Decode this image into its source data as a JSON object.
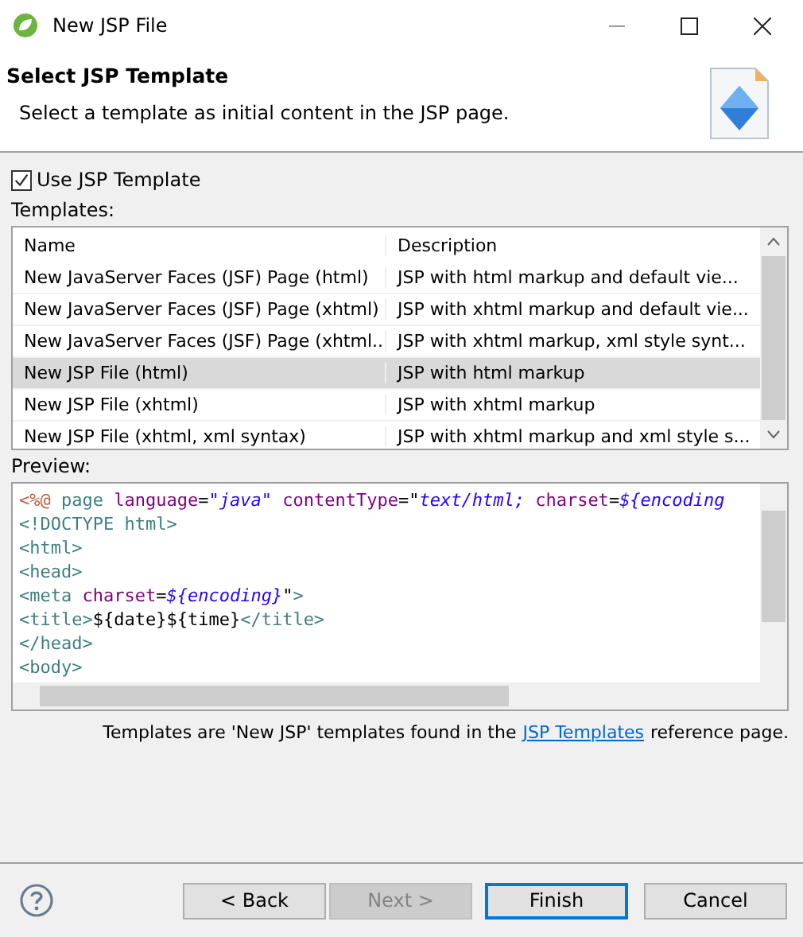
{
  "window": {
    "title": "New JSP File"
  },
  "header": {
    "title": "Select JSP Template",
    "description": "Select a template as initial content in the JSP page."
  },
  "use_template": {
    "label": "Use JSP Template",
    "checked": true
  },
  "templates": {
    "label": "Templates:",
    "columns": [
      "Name",
      "Description"
    ],
    "rows": [
      {
        "name": "New JavaServer Faces (JSF) Page (html)",
        "description": "JSP with html markup and default vie...",
        "selected": false
      },
      {
        "name": "New JavaServer Faces (JSF) Page (xhtml)",
        "description": "JSP with xhtml markup and default vie...",
        "selected": false
      },
      {
        "name": "New JavaServer Faces (JSF) Page (xhtml...",
        "description": "JSP with xhtml markup, xml style synt...",
        "selected": false
      },
      {
        "name": "New JSP File (html)",
        "description": "JSP with html markup",
        "selected": true
      },
      {
        "name": "New JSP File (xhtml)",
        "description": "JSP with xhtml markup",
        "selected": false
      },
      {
        "name": "New JSP File (xhtml, xml syntax)",
        "description": "JSP with xhtml markup and xml style s...",
        "selected": false
      }
    ]
  },
  "preview": {
    "label": "Preview:",
    "lines": [
      [
        {
          "kind": "directive",
          "text": "<%@"
        },
        {
          "kind": "tag",
          "text": " page"
        },
        {
          "kind": "attr",
          "text": " language"
        },
        {
          "kind": "plain",
          "text": "="
        },
        {
          "kind": "string",
          "text": "\"java\""
        },
        {
          "kind": "attr",
          "text": " contentType"
        },
        {
          "kind": "plain",
          "text": "=\""
        },
        {
          "kind": "string",
          "text": "text/html;"
        },
        {
          "kind": "attr",
          "text": " charset"
        },
        {
          "kind": "plain",
          "text": "="
        },
        {
          "kind": "string",
          "text": "${encoding"
        }
      ],
      [
        {
          "kind": "tag",
          "text": "<!DOCTYPE html>"
        }
      ],
      [
        {
          "kind": "tag",
          "text": "<html>"
        }
      ],
      [
        {
          "kind": "tag",
          "text": "<head>"
        }
      ],
      [
        {
          "kind": "tag",
          "text": "<meta"
        },
        {
          "kind": "attr",
          "text": " charset"
        },
        {
          "kind": "plain",
          "text": "="
        },
        {
          "kind": "string",
          "text": "${encoding}"
        },
        {
          "kind": "plain",
          "text": "\""
        },
        {
          "kind": "tag",
          "text": ">"
        }
      ],
      [
        {
          "kind": "tag",
          "text": "<title>"
        },
        {
          "kind": "plain",
          "text": "${date}${time}"
        },
        {
          "kind": "tag",
          "text": "</title>"
        }
      ],
      [
        {
          "kind": "tag",
          "text": "</head>"
        }
      ],
      [
        {
          "kind": "tag",
          "text": "<body>"
        }
      ]
    ]
  },
  "footer_note": {
    "before": "Templates are 'New JSP' templates found in the",
    "link": "JSP Templates",
    "after": "reference page."
  },
  "buttons": [
    {
      "label": "< Back",
      "disabled": false,
      "default": false
    },
    {
      "label": "Next >",
      "disabled": true,
      "default": false
    },
    {
      "label": "Finish",
      "disabled": false,
      "default": true
    },
    {
      "label": "Cancel",
      "disabled": false,
      "default": false
    }
  ]
}
